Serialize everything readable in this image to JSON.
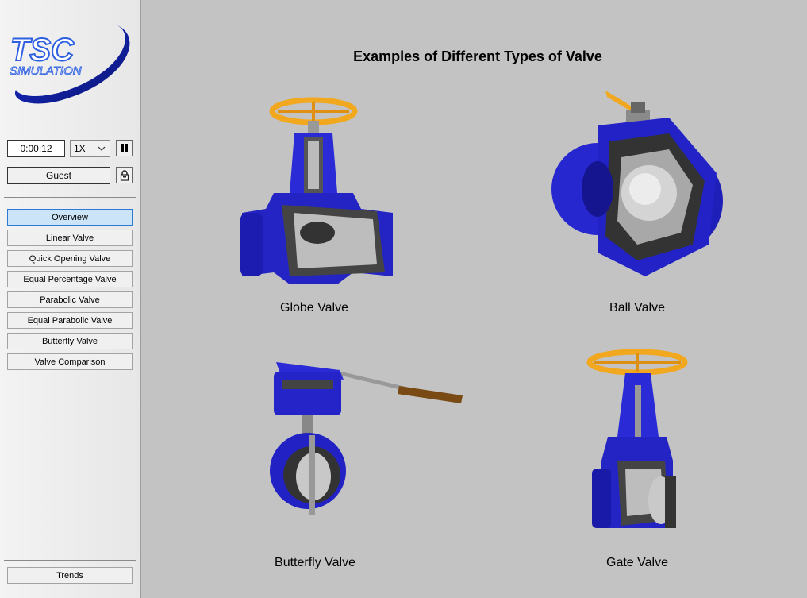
{
  "logo": {
    "line1": "TSC",
    "line2": "SIMULATION"
  },
  "controls": {
    "time": "0:00:12",
    "speed": "1X",
    "user": "Guest"
  },
  "nav": {
    "items": [
      {
        "label": "Overview",
        "active": true
      },
      {
        "label": "Linear Valve"
      },
      {
        "label": "Quick Opening Valve"
      },
      {
        "label": "Equal Percentage Valve"
      },
      {
        "label": "Parabolic Valve"
      },
      {
        "label": "Equal Parabolic Valve"
      },
      {
        "label": "Butterfly Valve"
      },
      {
        "label": "Valve Comparison"
      }
    ],
    "trends": "Trends"
  },
  "main": {
    "title": "Examples of Different Types of Valve",
    "valves": [
      {
        "label": "Globe Valve",
        "icon": "globe-valve-icon"
      },
      {
        "label": "Ball Valve",
        "icon": "ball-valve-icon"
      },
      {
        "label": "Butterfly Valve",
        "icon": "butterfly-valve-icon"
      },
      {
        "label": "Gate Valve",
        "icon": "gate-valve-icon"
      }
    ]
  },
  "colors": {
    "background": "#c3c3c3",
    "valve_body": "#2a2ad6",
    "handwheel": "#f2a81e",
    "active_nav": "#cce4f7"
  }
}
